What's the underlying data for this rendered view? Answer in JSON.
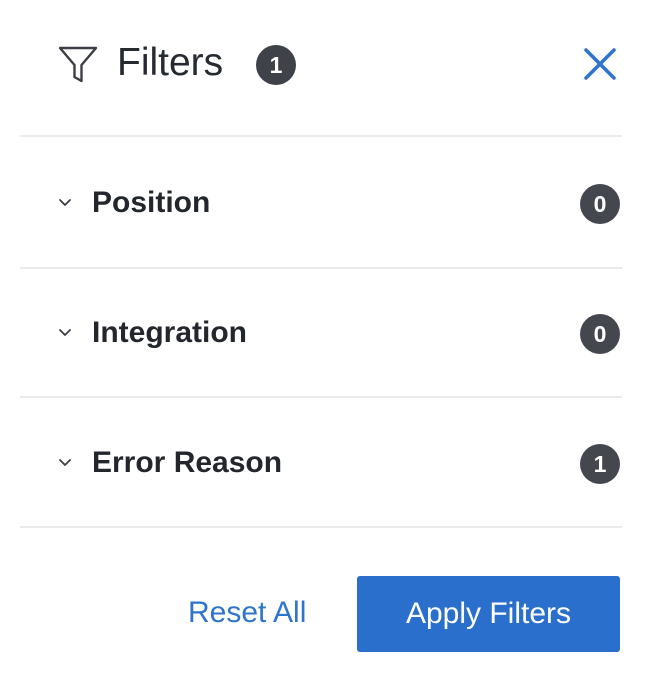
{
  "header": {
    "title": "Filters",
    "active_count": "1",
    "icon": "funnel-icon",
    "close_icon": "close-icon"
  },
  "sections": [
    {
      "label": "Position",
      "count": "0"
    },
    {
      "label": "Integration",
      "count": "0"
    },
    {
      "label": "Error Reason",
      "count": "1"
    }
  ],
  "footer": {
    "reset_label": "Reset All",
    "apply_label": "Apply Filters"
  },
  "colors": {
    "accent": "#2a6fcb",
    "link": "#2f74cc",
    "badge": "#44484e",
    "divider": "#e9ebed"
  }
}
